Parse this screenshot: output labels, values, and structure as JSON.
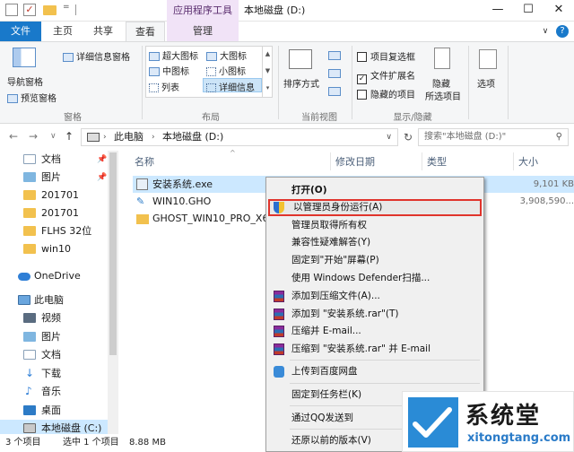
{
  "titlebar": {
    "context_tab": "应用程序工具",
    "window_title": "本地磁盘 (D:)",
    "quick_access_more": "=",
    "controls": {
      "minimize": "—",
      "maximize": "☐",
      "close": "✕"
    }
  },
  "tabs": {
    "file": "文件",
    "home": "主页",
    "share": "共享",
    "view": "查看",
    "manage": "管理",
    "expand": "∨",
    "help": "?"
  },
  "ribbon": {
    "panes": {
      "nav_pane": "导航窗格",
      "preview_pane": "预览窗格",
      "details_pane": "详细信息窗格",
      "group": "窗格"
    },
    "layout": {
      "extra_large": "超大图标",
      "large": "大图标",
      "medium": "中图标",
      "small": "小图标",
      "list": "列表",
      "details": "详细信息",
      "group": "布局"
    },
    "current_view": {
      "sort_by": "排序方式",
      "group": "当前视图"
    },
    "show_hide": {
      "item_checkboxes": "项目复选框",
      "file_extensions": "文件扩展名",
      "hidden_items": "隐藏的项目",
      "hide_selected": "隐藏",
      "hide_selected_2": "所选项目",
      "group": "显示/隐藏"
    },
    "options": "选项"
  },
  "address": {
    "back": "←",
    "forward": "→",
    "dropdown": "∨",
    "up": "↑",
    "crumbs": [
      "此电脑",
      "本地磁盘 (D:)"
    ],
    "search_placeholder": "搜索\"本地磁盘 (D:)\""
  },
  "nav": {
    "items": [
      {
        "label": "文档",
        "pinned": true
      },
      {
        "label": "图片",
        "pinned": true
      },
      {
        "label": "201701"
      },
      {
        "label": "201701"
      },
      {
        "label": "FLHS 32位"
      },
      {
        "label": "win10"
      },
      {
        "label": "OneDrive"
      },
      {
        "label": "此电脑"
      },
      {
        "label": "视频"
      },
      {
        "label": "图片"
      },
      {
        "label": "文档"
      },
      {
        "label": "下载"
      },
      {
        "label": "音乐"
      },
      {
        "label": "桌面"
      },
      {
        "label": "本地磁盘 (C:)"
      }
    ],
    "pin_icon": "📌"
  },
  "columns": {
    "name": "名称",
    "date": "修改日期",
    "type": "类型",
    "size": "大小"
  },
  "files": [
    {
      "name": "安装系统.exe",
      "size": "9,101 KB"
    },
    {
      "name": "WIN10.GHO",
      "size": "3,908,590..."
    },
    {
      "name": "GHOST_WIN10_PRO_X64_",
      "size": ""
    }
  ],
  "status": {
    "count": "3 个项目",
    "selected": "选中 1 个项目",
    "size": "8.88 MB"
  },
  "context_menu": {
    "open": "打开(O)",
    "run_as_admin": "以管理员身份运行(A)",
    "take_ownership": "管理员取得所有权",
    "compat": "兼容性疑难解答(Y)",
    "pin_start": "固定到\"开始\"屏幕(P)",
    "defender": "使用 Windows Defender扫描...",
    "add_archive": "添加到压缩文件(A)...",
    "add_rar": "添加到 \"安装系统.rar\"(T)",
    "compress_email": "压缩并 E-mail...",
    "compress_rar_email": "压缩到 \"安装系统.rar\" 并 E-mail",
    "baidu": "上传到百度网盘",
    "pin_taskbar": "固定到任务栏(K)",
    "qq": "通过QQ发送到",
    "restore": "还原以前的版本(V)"
  },
  "watermark": {
    "title": "系统堂",
    "url": "xitongtang.com"
  },
  "colors": {
    "accent": "#1979ca",
    "selection": "#cce8ff",
    "highlight_border": "#e0342c",
    "manage_tab": "#f1e3f7"
  }
}
